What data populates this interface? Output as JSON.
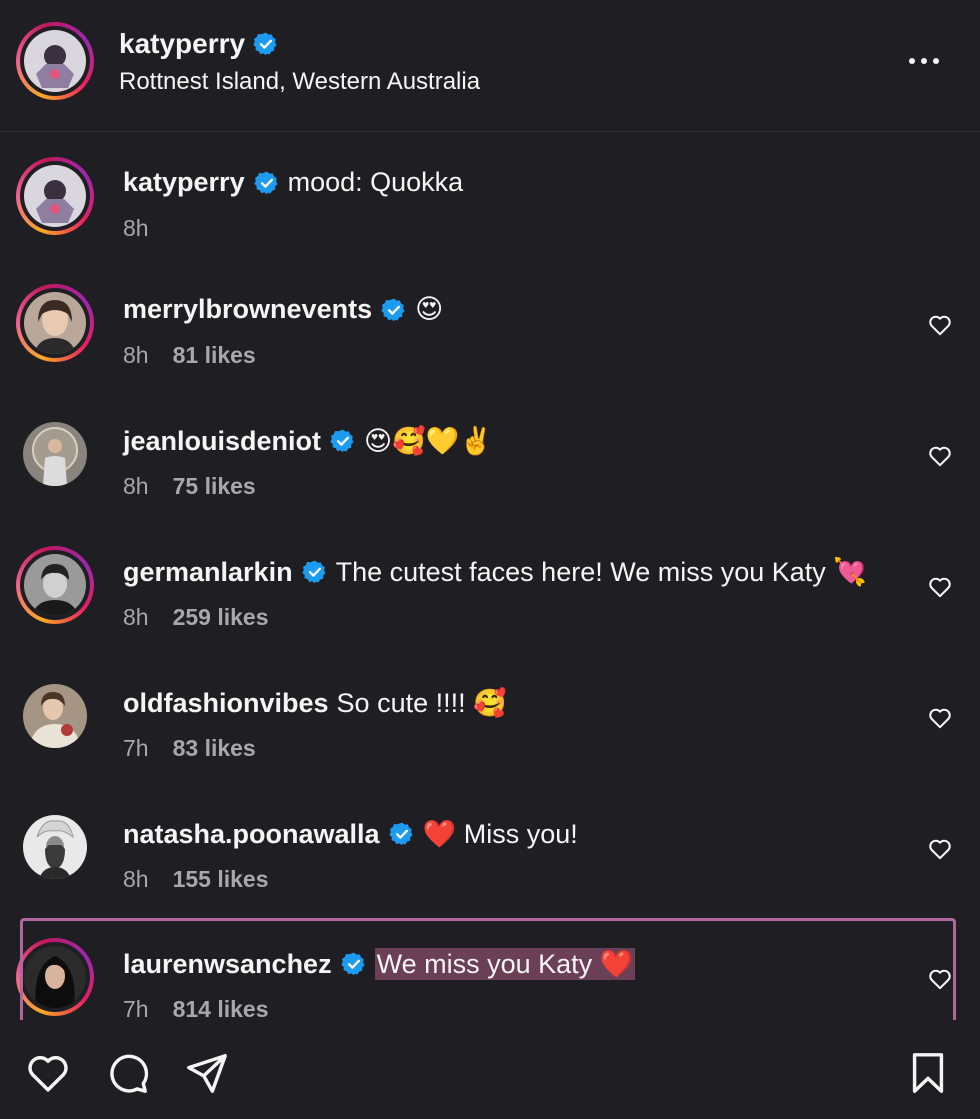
{
  "header": {
    "username": "katyperry",
    "location": "Rottnest Island, Western Australia",
    "more_icon": "ellipsis-icon"
  },
  "comments": [
    {
      "username": "katyperry",
      "text": "mood: Quokka",
      "time": "8h",
      "likes": "",
      "verified": true,
      "ring": true
    },
    {
      "username": "merrylbrownevents",
      "text": "😍",
      "time": "8h",
      "likes": "81 likes",
      "verified": true,
      "ring": true
    },
    {
      "username": "jeanlouisdeniot",
      "text": "😍🥰💛✌️",
      "time": "8h",
      "likes": "75 likes",
      "verified": true,
      "ring": false
    },
    {
      "username": "germanlarkin",
      "text": "The cutest faces here! We miss you Katy 💘",
      "time": "8h",
      "likes": "259 likes",
      "verified": true,
      "ring": true
    },
    {
      "username": "oldfashionvibes",
      "text": "So cute !!!! 🥰",
      "time": "7h",
      "likes": "83 likes",
      "verified": false,
      "ring": false
    },
    {
      "username": "natasha.poonawalla",
      "text": "❤️ Miss you!",
      "time": "8h",
      "likes": "155 likes",
      "verified": true,
      "ring": false
    },
    {
      "username": "laurenwsanchez",
      "text": "We miss you Katy ❤️",
      "time": "7h",
      "likes": "814 likes",
      "verified": true,
      "ring": true
    }
  ],
  "actions": {
    "like_icon": "heart-icon",
    "comment_icon": "comment-icon",
    "share_icon": "send-icon",
    "save_icon": "bookmark-icon"
  },
  "colors": {
    "background": "#1f1f23",
    "verified": "#1d9bf0",
    "secondary_text": "#a8a8a8",
    "highlight_border": "#b2679c",
    "selection": "#6b3f55"
  }
}
